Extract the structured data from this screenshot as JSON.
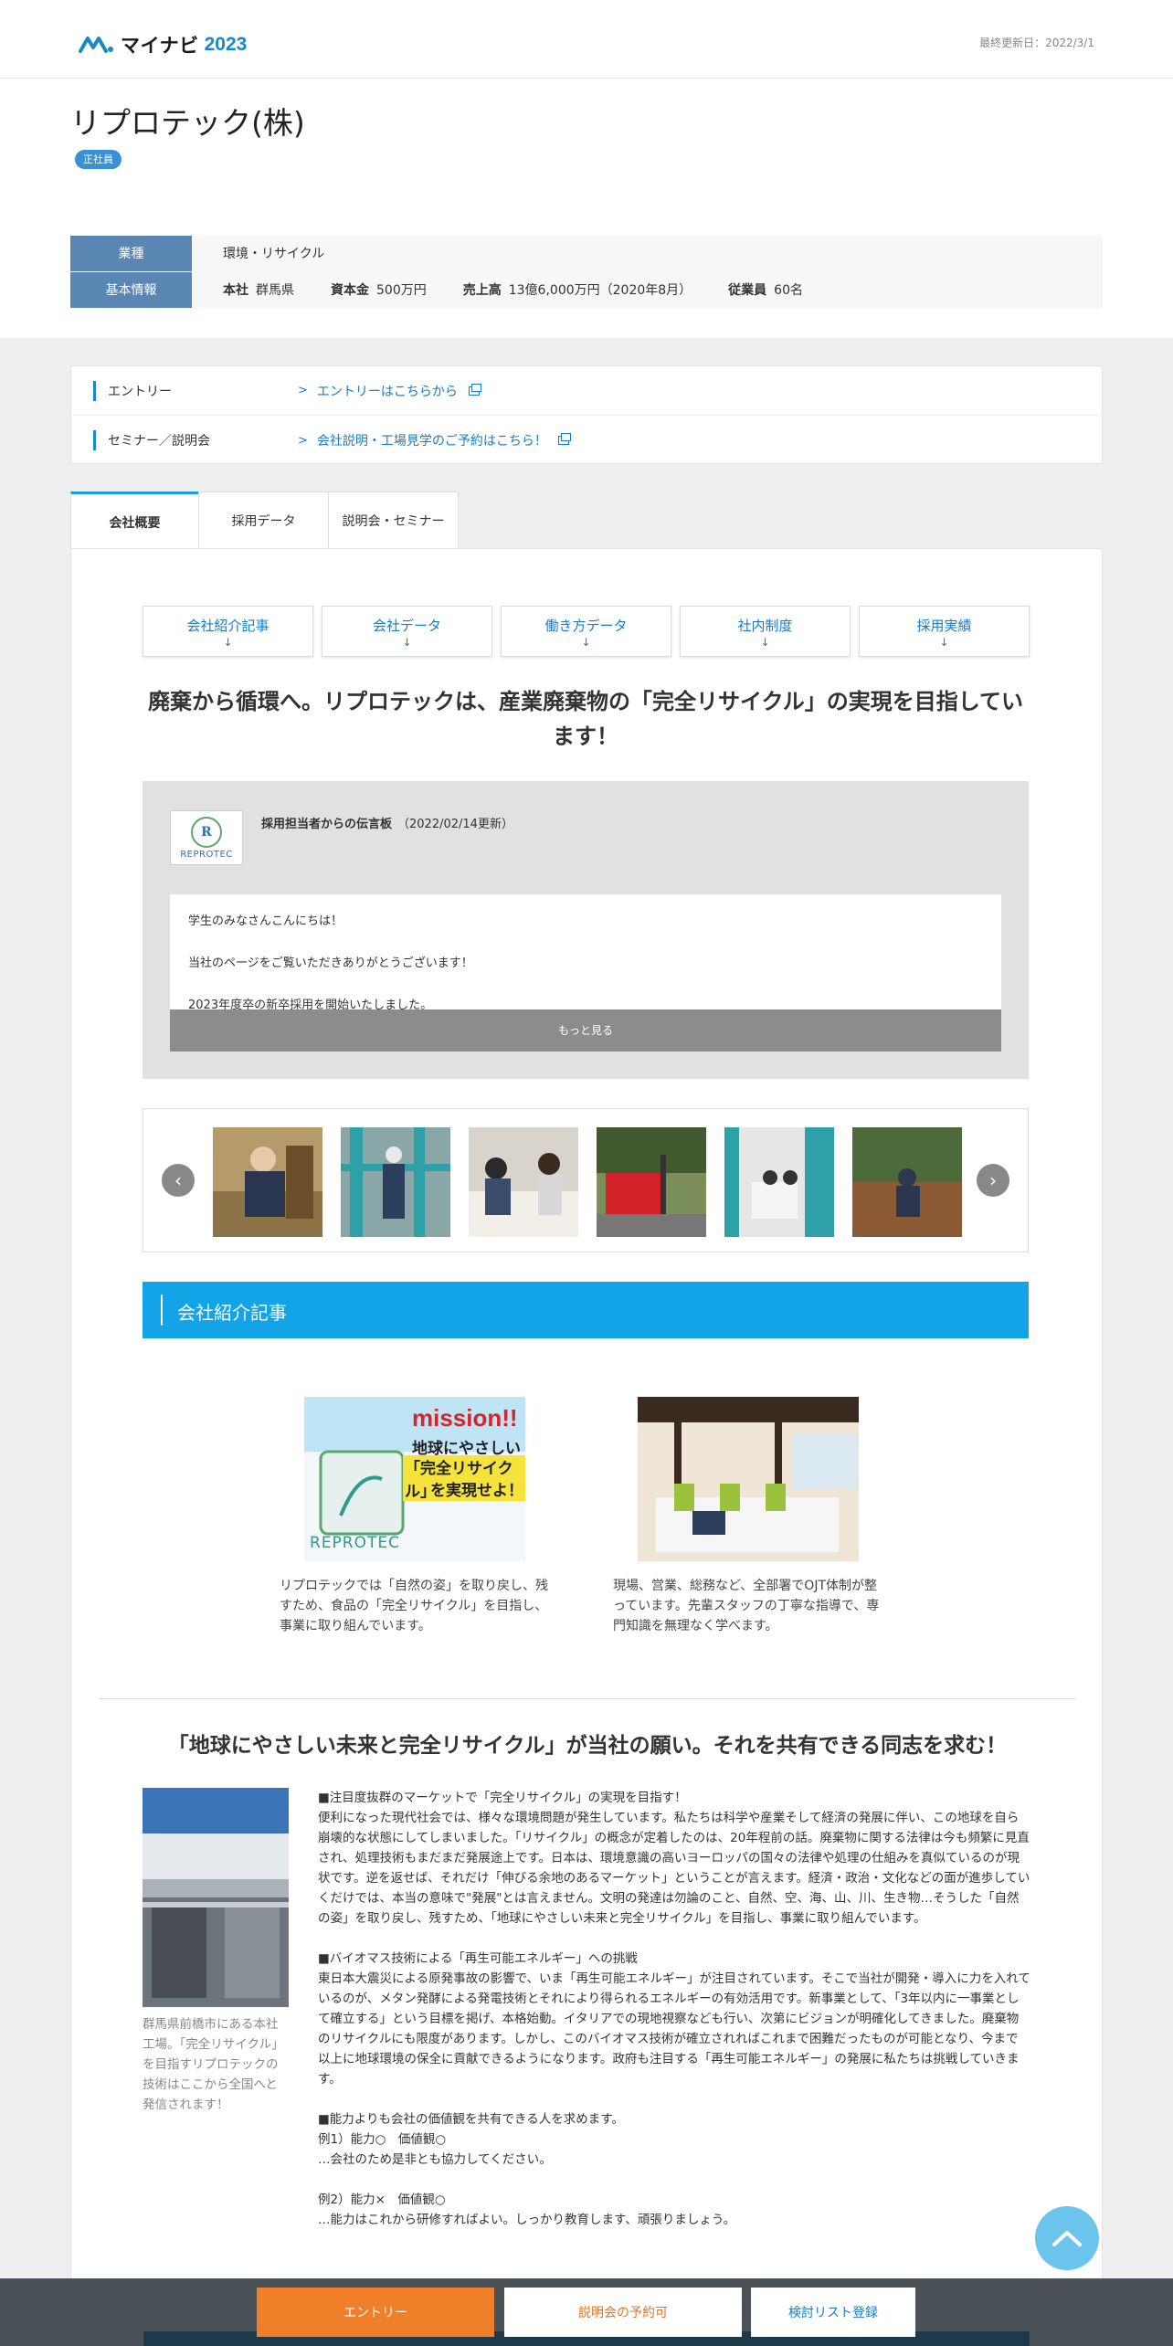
{
  "header": {
    "logo_text": "マイナビ",
    "logo_year": "2023",
    "last_updated": "最終更新日：2022/3/1"
  },
  "company": {
    "name": "リプロテック(株)",
    "badge": "正社員",
    "industry_label": "業種",
    "industry_value": "環境・リサイクル",
    "basic_label": "基本情報",
    "hq_label": "本社",
    "hq_value": "群馬県",
    "capital_label": "資本金",
    "capital_value": "500万円",
    "sales_label": "売上高",
    "sales_value": "13億6,000万円（2020年8月）",
    "employees_label": "従業員",
    "employees_value": "60名"
  },
  "entry_links": [
    {
      "label": "エントリー",
      "link": "エントリーはこちらから"
    },
    {
      "label": "セミナー／説明会",
      "link": "会社説明・工場見学のご予約はこちら！"
    }
  ],
  "tabs": [
    {
      "label": "会社概要"
    },
    {
      "label": "採用データ"
    },
    {
      "label": "説明会・セミナー"
    }
  ],
  "quick_nav": [
    {
      "label": "会社紹介記事",
      "arrow": "↓"
    },
    {
      "label": "会社データ",
      "arrow": "↓"
    },
    {
      "label": "働き方データ",
      "arrow": "↓"
    },
    {
      "label": "社内制度",
      "arrow": "↓"
    },
    {
      "label": "採用実績",
      "arrow": "↓"
    }
  ],
  "headline": "廃棄から循環へ。リプロテックは、産業廃棄物の「完全リサイクル」の実現を目指しています！",
  "message": {
    "logo_mark": "R",
    "logo_name": "REPROTEC",
    "title": "採用担当者からの伝言板",
    "date": "（2022/02/14更新）",
    "lines": [
      "学生のみなさんこんにちは！",
      "当社のページをご覧いただきありがとうございます！",
      "2023年度卒の新卒採用を開始いたしました。"
    ],
    "more": "もっと見る"
  },
  "gallery": {
    "prev": "‹",
    "next": "›"
  },
  "section_title": "会社紹介記事",
  "articles": [
    {
      "image_text_1": "mission!!",
      "image_text_2": "地球にやさしい",
      "image_text_3": "「完全リサイクル」",
      "image_text_4": "を実現せよ！",
      "image_brand": "REPROTEC",
      "desc": "リプロテックでは「自然の姿」を取り戻し、残すため、食品の「完全リサイクル」を目指し、事業に取り組んでいます。"
    },
    {
      "desc": "現場、営業、総務など、全部署でOJT体制が整っています。先輩スタッフの丁寧な指導で、専門知識を無理なく学べます。"
    }
  ],
  "headline2": "「地球にやさしい未来と完全リサイクル」が当社の願い。それを共有できる同志を求む！",
  "side_caption": "群馬県前橋市にある本社工場。「完全リサイクル」を目指すリプロテックの技術はここから全国へと発信されます！",
  "body": [
    "■注目度抜群のマーケットで「完全リサイクル」の実現を目指す！\n便利になった現代社会では、様々な環境問題が発生しています。私たちは科学や産業そして経済の発展に伴い、この地球を自ら崩壊的な状態にしてしまいました。「リサイクル」の概念が定着したのは、20年程前の話。廃棄物に関する法律は今も頻繁に見直され、処理技術もまだまだ発展途上です。日本は、環境意識の高いヨーロッパの国々の法律や処理の仕組みを真似ているのが現状です。逆を返せば、それだけ「伸びる余地のあるマーケット」ということが言えます。経済・政治・文化などの面が進歩していくだけでは、本当の意味で\"発展\"とは言えません。文明の発達は勿論のこと、自然、空、海、山、川、生き物…そうした「自然の姿」を取り戻し、残すため、「地球にやさしい未来と完全リサイクル」を目指し、事業に取り組んでいます。",
    "■バイオマス技術による「再生可能エネルギー」への挑戦\n東日本大震災による原発事故の影響で、いま「再生可能エネルギー」が注目されています。そこで当社が開発・導入に力を入れているのが、メタン発酵による発電技術とそれにより得られるエネルギーの有効活用です。新事業として、「3年以内に一事業として確立する」という目標を掲げ、本格始動。イタリアでの現地視察なども行い、次第にビジョンが明確化してきました。廃棄物のリサイクルにも限度があります。しかし、このバイオマス技術が確立されればこれまで困難だったものが可能となり、今まで以上に地球環境の保全に貢献できるようになります。政府も注目する「再生可能エネルギー」の発展に私たちは挑戦していきます。",
    "■能力よりも会社の価値観を共有できる人を求めます。\n例1）能力○　価値観○\n…会社のため是非とも協力してください。",
    "例2）能力×　価値観○\n…能力はこれから研修すればよい。しっかり教育します、頑張りましょう。"
  ],
  "bottom_bar": {
    "entry": "エントリー",
    "seminar": "説明会の予約可",
    "list": "検討リスト登録"
  }
}
